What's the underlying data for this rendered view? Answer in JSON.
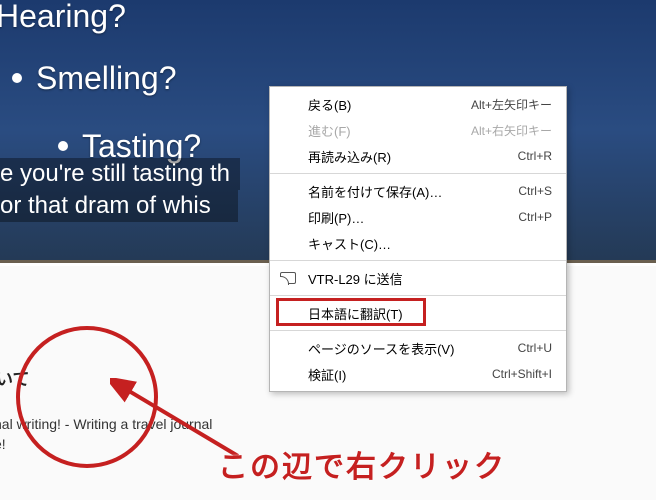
{
  "slide": {
    "line1": "Hearing?",
    "line2": "Smelling?",
    "line3": "Tasting?",
    "highlight1": "e you're still tasting th",
    "highlight2": " or that dram of whis"
  },
  "lower": {
    "title_fragment": "いて",
    "body_fragment": "nal writing! - Writing a travel journal",
    "body_tail": "e!"
  },
  "annotation": {
    "text": "この辺で右クリック"
  },
  "ctx": {
    "back": {
      "label": "戻る(B)",
      "shortcut": "Alt+左矢印キー"
    },
    "forward": {
      "label": "進む(F)",
      "shortcut": "Alt+右矢印キー"
    },
    "reload": {
      "label": "再読み込み(R)",
      "shortcut": "Ctrl+R"
    },
    "saveas": {
      "label": "名前を付けて保存(A)…",
      "shortcut": "Ctrl+S"
    },
    "print": {
      "label": "印刷(P)…",
      "shortcut": "Ctrl+P"
    },
    "cast": {
      "label": "キャスト(C)…",
      "shortcut": ""
    },
    "send": {
      "label": "VTR-L29 に送信",
      "shortcut": ""
    },
    "translate": {
      "label": "日本語に翻訳(T)",
      "shortcut": ""
    },
    "viewsrc": {
      "label": "ページのソースを表示(V)",
      "shortcut": "Ctrl+U"
    },
    "inspect": {
      "label": "検証(I)",
      "shortcut": "Ctrl+Shift+I"
    }
  }
}
